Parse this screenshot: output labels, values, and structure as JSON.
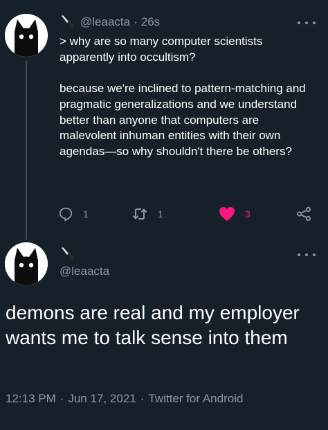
{
  "colors": {
    "background": "#15202b",
    "text_primary": "#ffffff",
    "text_secondary": "#8b98a5",
    "like_active": "#f91880",
    "thread_line": "#3d5466"
  },
  "parent_tweet": {
    "avatar_icon": "black-cat-avatar",
    "name_icon": "knife-emoji",
    "handle": "@leaacta",
    "separator": "·",
    "timestamp": "26s",
    "more_icon": "more-dots-icon",
    "lines": [
      "> why are so many computer scientists apparently into occultism?",
      "because we're inclined to pattern-matching and pragmatic generalizations and we understand better than anyone that computers are malevolent inhuman entities with their own agendas—so why shouldn't there be others?"
    ],
    "actions": {
      "reply": {
        "icon": "reply-icon",
        "count": "1"
      },
      "retweet": {
        "icon": "retweet-icon",
        "count": "1"
      },
      "like": {
        "icon": "heart-icon",
        "count": "3",
        "active": true
      },
      "share": {
        "icon": "share-icon"
      }
    }
  },
  "main_tweet": {
    "avatar_icon": "black-cat-avatar",
    "name_icon": "knife-emoji",
    "handle": "@leaacta",
    "more_icon": "more-dots-icon",
    "text": "demons are real and my employer wants me to talk sense into them",
    "time": "12:13 PM",
    "separator1": "·",
    "date": "Jun 17, 2021",
    "separator2": "·",
    "client": "Twitter for Android"
  }
}
